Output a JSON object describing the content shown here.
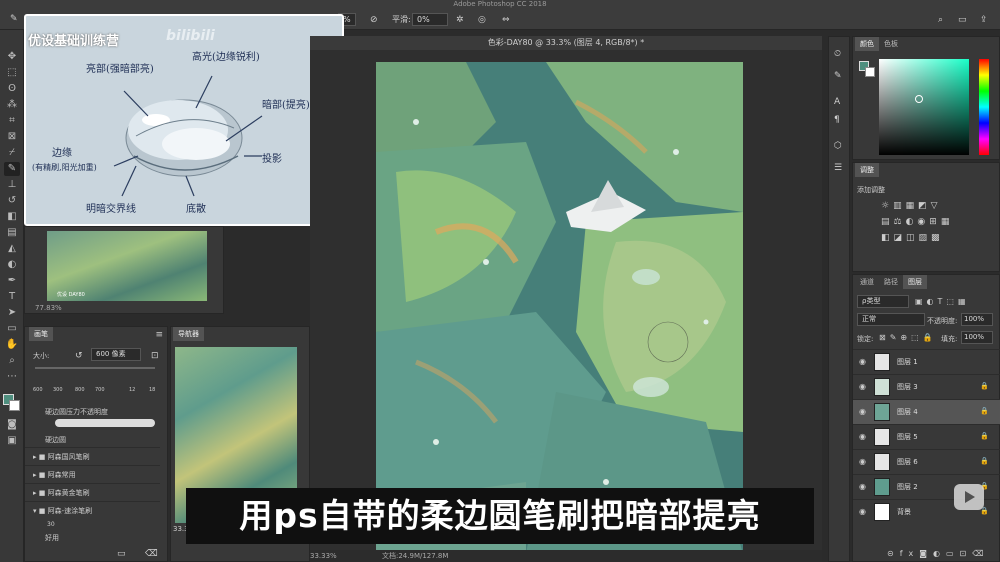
{
  "app": {
    "title": "Adobe Photoshop CC 2018"
  },
  "options": {
    "pct_value": "%",
    "smooth_label": "平滑:",
    "smooth_value": "0%"
  },
  "document": {
    "tab_title": "色彩-DAY80 @ 33.3% (图层 4, RGB/8*) *",
    "zoom": "33.33%",
    "file_info": "文档:24.9M/127.8M"
  },
  "reference": {
    "brand": "优设基础训练营",
    "annotations": {
      "highlight": "亮部(强暗部亮)",
      "gloss": "高光(边缘锐利)",
      "dark": "暗部(提亮)",
      "edge": "边缘",
      "edge_sub": "(有精刷,阳光加重)",
      "shadow": "投影",
      "terminator": "明暗交界线",
      "bottom": "底散"
    },
    "zoom": "77.83%",
    "thumb_caption": "优设 DAY80"
  },
  "brush_panel": {
    "tab": "画笔",
    "size_label": "大小:",
    "size_value": "600 像素",
    "preset_sizes": [
      "600",
      "300",
      "800",
      "700",
      "12",
      "18"
    ],
    "preset_label_1": "硬边圆压力不透明度",
    "preset_label_2": "硬边圆",
    "groups": [
      "阿森国风笔刷",
      "阿森常用",
      "阿森黄金笔刷",
      "阿森-速涂笔刷"
    ],
    "current_brush": "好用",
    "current_size": "30"
  },
  "navigator": {
    "tab": "导航器",
    "zoom": "33.33%"
  },
  "color_panel": {
    "tabs": [
      "颜色",
      "色板"
    ],
    "fg_color": "#4f8f7f",
    "bg_color": "#ffffff"
  },
  "adjust_panel": {
    "tab": "调整",
    "title": "添加调整"
  },
  "layers_panel": {
    "tabs": [
      "通道",
      "路径",
      "图层"
    ],
    "filter": "ρ类型",
    "blend": "正常",
    "opacity_label": "不透明度:",
    "opacity": "100%",
    "lock_label": "锁定:",
    "fill_label": "填充:",
    "fill": "100%",
    "layers": [
      {
        "name": "图层 1",
        "locked": false,
        "active": false
      },
      {
        "name": "图层 3",
        "locked": true,
        "active": false
      },
      {
        "name": "图层 4",
        "locked": true,
        "active": true
      },
      {
        "name": "图层 5",
        "locked": true,
        "active": false
      },
      {
        "name": "图层 6",
        "locked": true,
        "active": false
      },
      {
        "name": "图层 2",
        "locked": true,
        "active": false
      },
      {
        "name": "背景",
        "locked": true,
        "active": false
      }
    ],
    "lock_glyph": "🔒"
  },
  "subtitle": "用ps自带的柔边圆笔刷把暗部提亮",
  "colors": {
    "accent": "#4f8f7f",
    "canvas_bg": "#5a9a8a",
    "pad": "#8ab877"
  }
}
